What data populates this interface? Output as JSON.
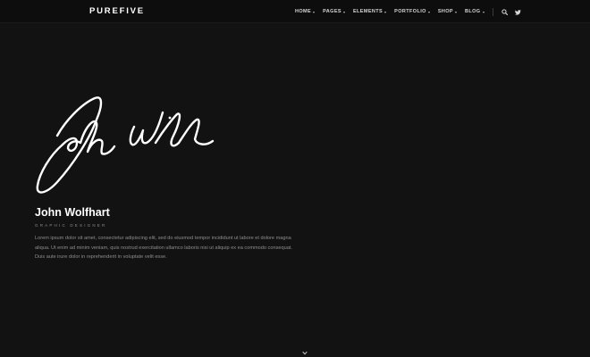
{
  "header": {
    "logo": "PUREFIVE",
    "menu": [
      {
        "label": "HOME"
      },
      {
        "label": "PAGES"
      },
      {
        "label": "ELEMENTS"
      },
      {
        "label": "PORTFOLIO"
      },
      {
        "label": "SHOP"
      },
      {
        "label": "BLOG"
      }
    ],
    "icons": [
      "search-icon",
      "twitter-icon"
    ]
  },
  "hero": {
    "signature_alt": "John Wolfhart",
    "name": "John Wolfhart",
    "role": "GRAPHIC DESIGNER",
    "description": "Lorem ipsum dolor sit amet, consectetur adipiscing elit, sed do eiusmod tempor incididunt ut labore et dolore magna aliqua. Ut enim ad minim veniam, quis nostrud exercitation ullamco laboris nisi ut aliquip ex ea commodo consequat. Duis aute irure dolor in reprehenderit in voluptate velit esse."
  },
  "scroll_icon": "chevron-down-icon",
  "colors": {
    "background": "#121212",
    "navbar": "#0d0d0d",
    "text": "#ffffff",
    "muted": "#8e8e8e"
  }
}
